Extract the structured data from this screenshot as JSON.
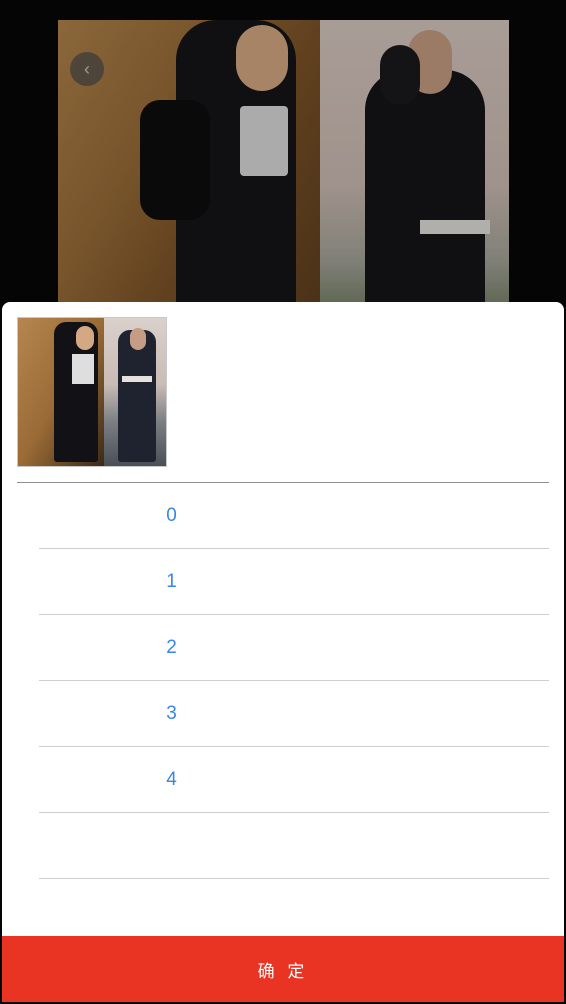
{
  "product": {
    "image_icon": "product-photo-two-women-black-tracksuit",
    "back_icon": "back-arrow-icon"
  },
  "sheet": {
    "thumbnail_icon": "product-thumbnail",
    "options": [
      {
        "label": "0"
      },
      {
        "label": "1"
      },
      {
        "label": "2"
      },
      {
        "label": "3"
      },
      {
        "label": "4"
      },
      {
        "label": ""
      }
    ],
    "confirm_label": "确 定"
  },
  "colors": {
    "accent": "#3a86e8",
    "confirm_bg": "#e93424",
    "sheet_bg": "#ffffff"
  }
}
